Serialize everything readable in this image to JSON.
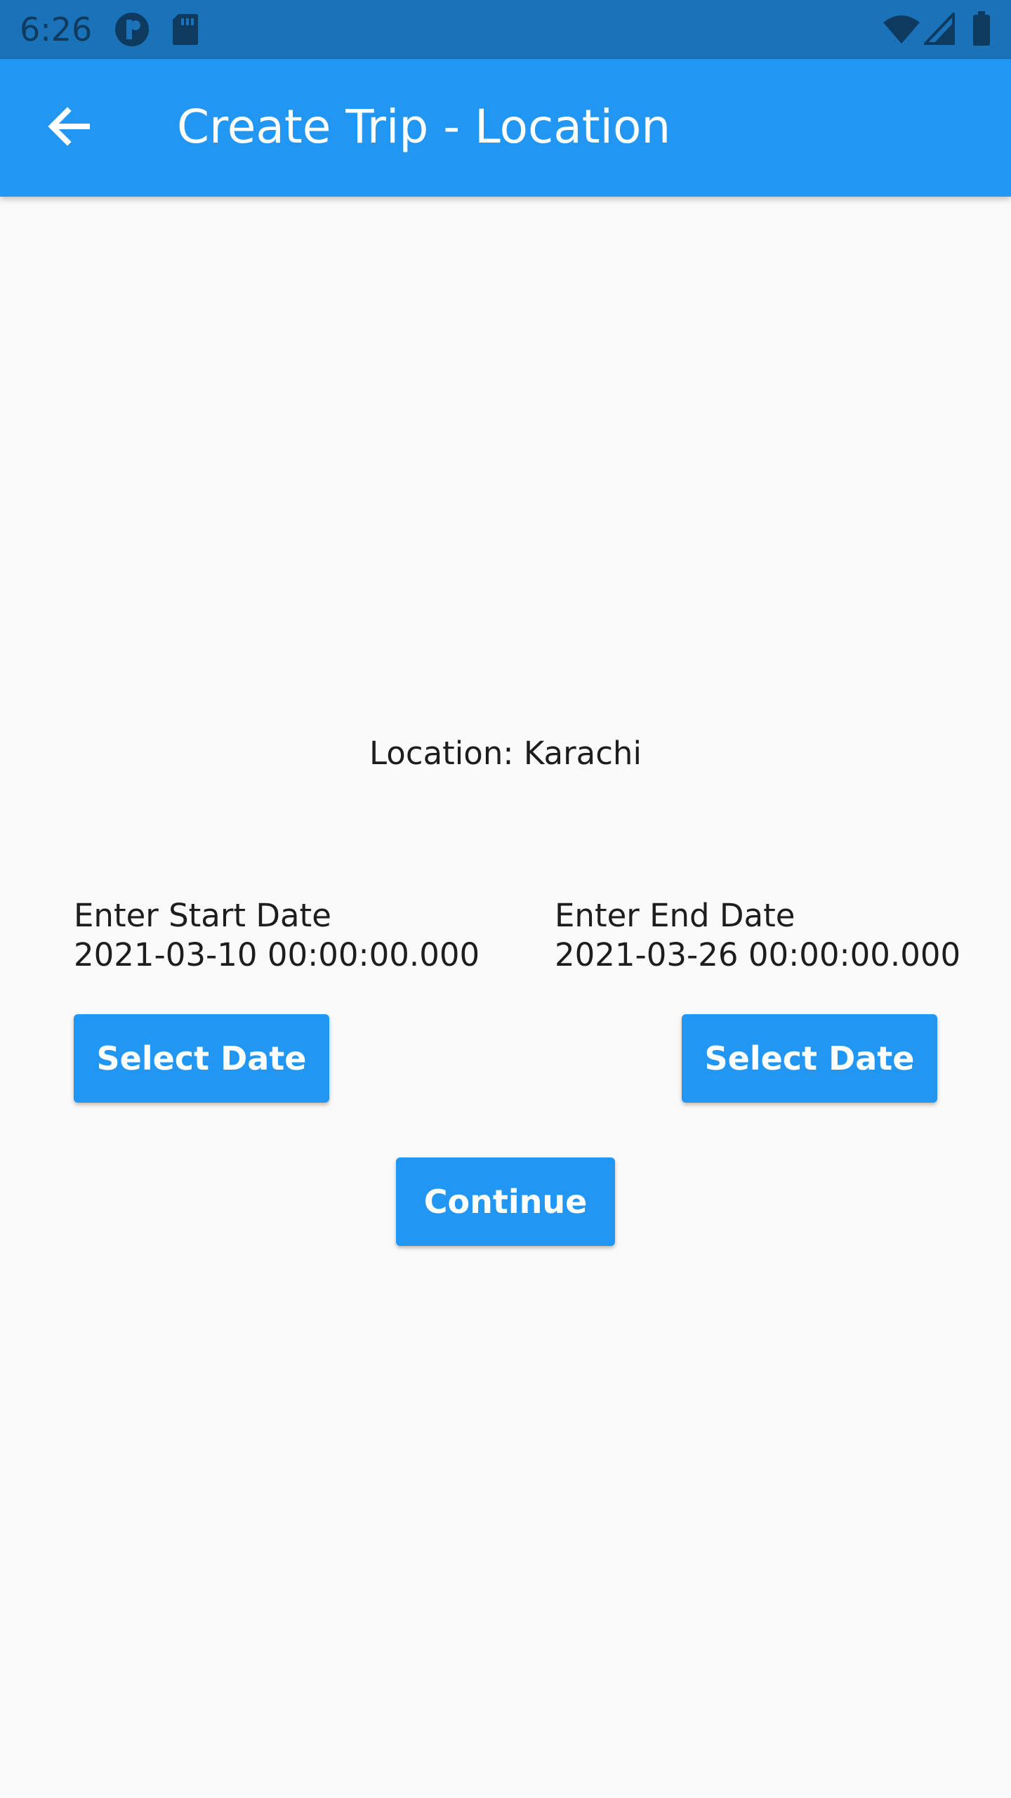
{
  "status_bar": {
    "time": "6:26",
    "icons": [
      "notification-icon",
      "sd-card-icon",
      "wifi-icon",
      "signal-icon",
      "battery-icon"
    ]
  },
  "app_bar": {
    "back_icon": "arrow-back-icon",
    "title": "Create Trip - Location"
  },
  "location": {
    "text": "Location: Karachi"
  },
  "start_date": {
    "label": "Enter Start Date",
    "value": "2021-03-10 00:00:00.000",
    "button_label": "Select Date"
  },
  "end_date": {
    "label": "Enter End Date",
    "value": "2021-03-26 00:00:00.000",
    "button_label": "Select Date"
  },
  "continue_button": {
    "label": "Continue"
  },
  "colors": {
    "primary": "#2196f3",
    "status_bar": "#1a72b9",
    "background": "#fafafa"
  }
}
